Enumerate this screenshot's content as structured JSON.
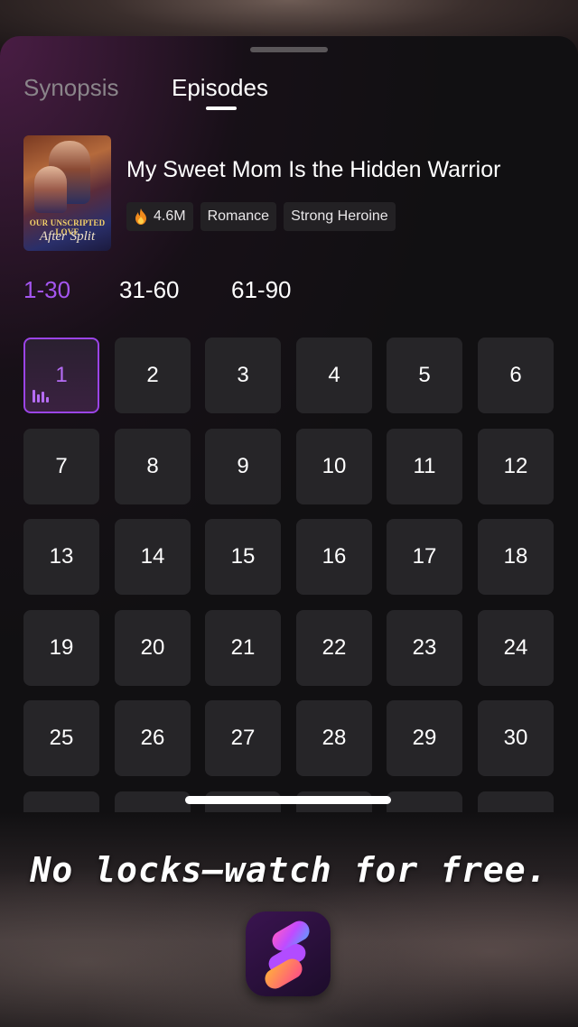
{
  "tabs": {
    "synopsis": "Synopsis",
    "episodes": "Episodes",
    "active": "Episodes"
  },
  "show": {
    "title": "My Sweet Mom Is the Hidden Warrior",
    "cover_text_line1": "OUR UNSCRIPTED LOVE",
    "cover_text_line2": "After Split",
    "views": "4.6M",
    "tags": [
      "Romance",
      "Strong Heroine"
    ]
  },
  "ranges": {
    "items": [
      "1-30",
      "31-60",
      "61-90"
    ],
    "active": "1-30"
  },
  "episodes": {
    "items": [
      "1",
      "2",
      "3",
      "4",
      "5",
      "6",
      "7",
      "8",
      "9",
      "10",
      "11",
      "12",
      "13",
      "14",
      "15",
      "16",
      "17",
      "18",
      "19",
      "20",
      "21",
      "22",
      "23",
      "24",
      "25",
      "26",
      "27",
      "28",
      "29",
      "30"
    ],
    "current": "1"
  },
  "promo": {
    "text": "No locks—watch for free."
  },
  "icons": {
    "views": "flame-icon",
    "current_episode": "playing-bars-icon",
    "app": "app-logo-icon"
  },
  "colors": {
    "accent": "#a455f0",
    "tile_bg": "#262528",
    "sheet_bg": "#111012"
  }
}
